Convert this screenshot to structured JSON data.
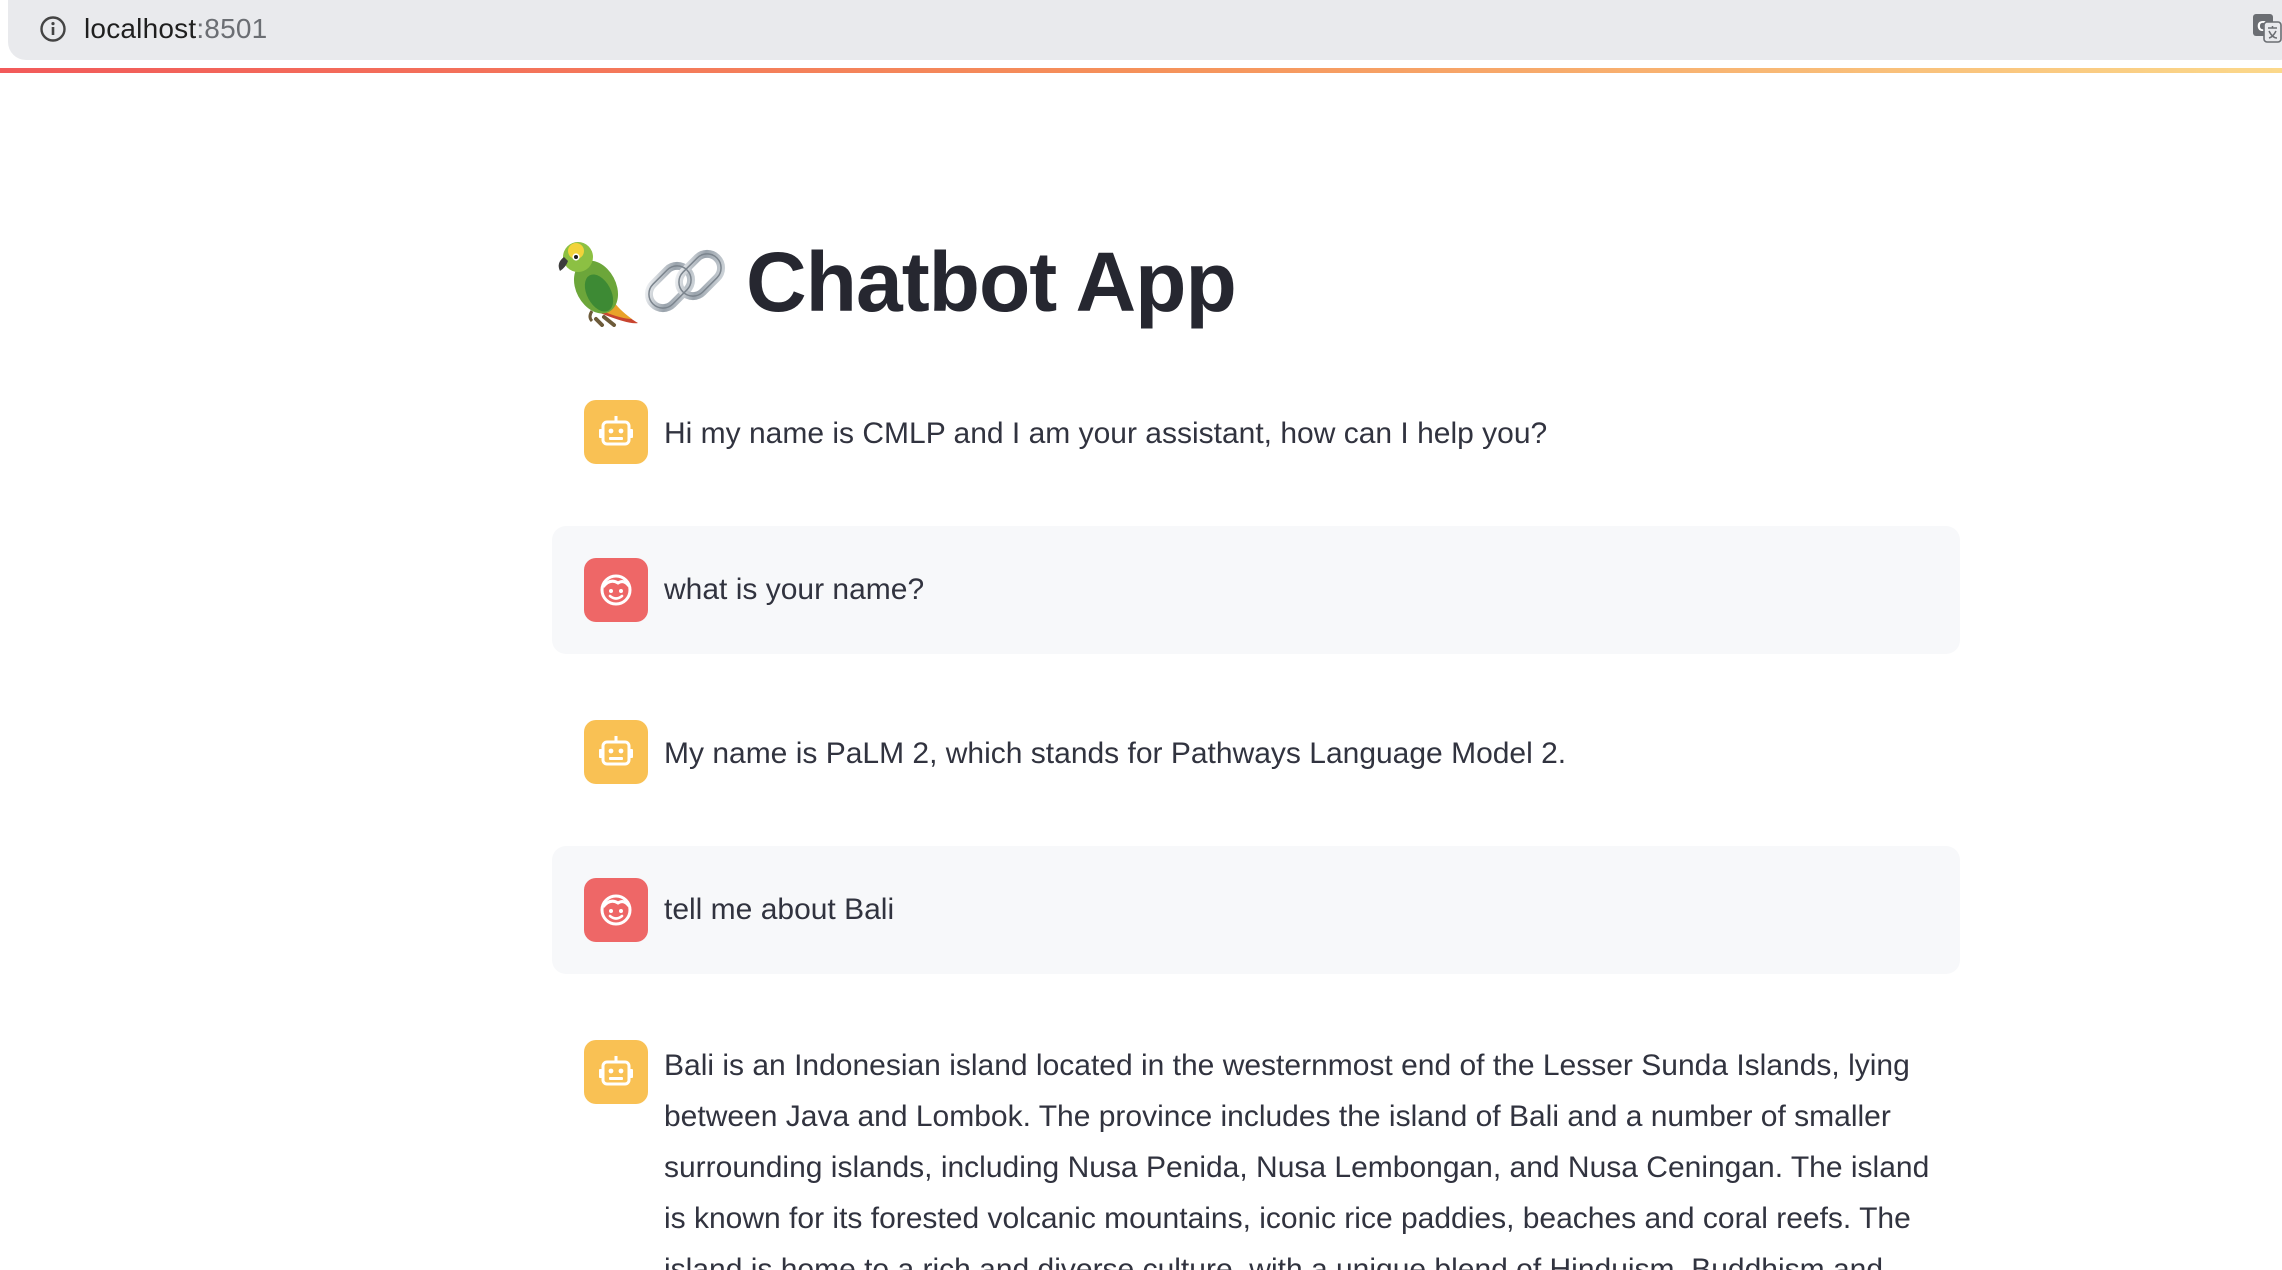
{
  "browser": {
    "url_host": "localhost",
    "url_port": ":8501"
  },
  "app": {
    "title": "Chatbot App",
    "title_emojis": [
      "parrot-emoji",
      "link-emoji"
    ]
  },
  "messages": [
    {
      "role": "assistant",
      "avatar": "robot-face-icon",
      "text": "Hi my name is CMLP and I am your assistant, how can I help you?"
    },
    {
      "role": "user",
      "avatar": "smiling-face-icon",
      "text": "what is your name?"
    },
    {
      "role": "assistant",
      "avatar": "robot-face-icon",
      "text": "My name is PaLM 2, which stands for Pathways Language Model 2."
    },
    {
      "role": "user",
      "avatar": "smiling-face-icon",
      "text": "tell me about Bali"
    },
    {
      "role": "assistant",
      "avatar": "robot-face-icon",
      "text": "Bali is an Indonesian island located in the westernmost end of the Lesser Sunda Islands, lying between Java and Lombok. The province includes the island of Bali and a number of smaller surrounding islands, including Nusa Penida, Nusa Lembongan, and Nusa Ceningan. The island is known for its forested volcanic mountains, iconic rice paddies, beaches and coral reefs. The island is home to a rich and diverse culture, with a unique blend of Hinduism, Buddhism and"
    }
  ],
  "colors": {
    "bot_avatar": "#f9c154",
    "user_avatar": "#ee6767",
    "user_bubble": "#f7f8fa",
    "text": "#31333f",
    "title": "#262730"
  }
}
